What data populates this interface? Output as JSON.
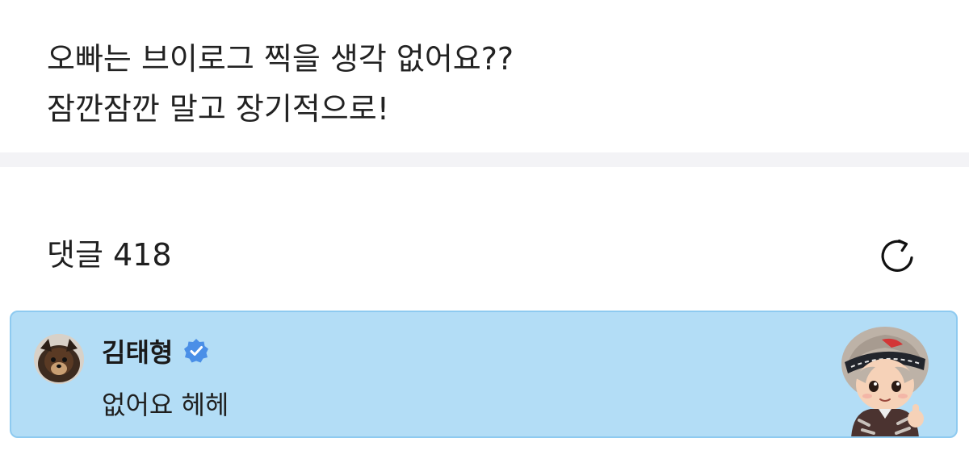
{
  "post": {
    "line1": "오빠는 브이로그 찍을 생각 없어요??",
    "line2": "잠깐잠깐 말고 장기적으로!"
  },
  "comments": {
    "title": "댓글 418",
    "refresh_icon": "refresh-icon"
  },
  "comment": {
    "author": "김태형",
    "verified_icon": "verified-badge-icon",
    "text": "없어요 헤헤",
    "sticker": "character-sticker"
  },
  "colors": {
    "highlight_background": "#b3ddf6",
    "highlight_border": "#8ecaf0",
    "verified_blue": "#4a8fe7",
    "divider": "#f3f3f6"
  }
}
